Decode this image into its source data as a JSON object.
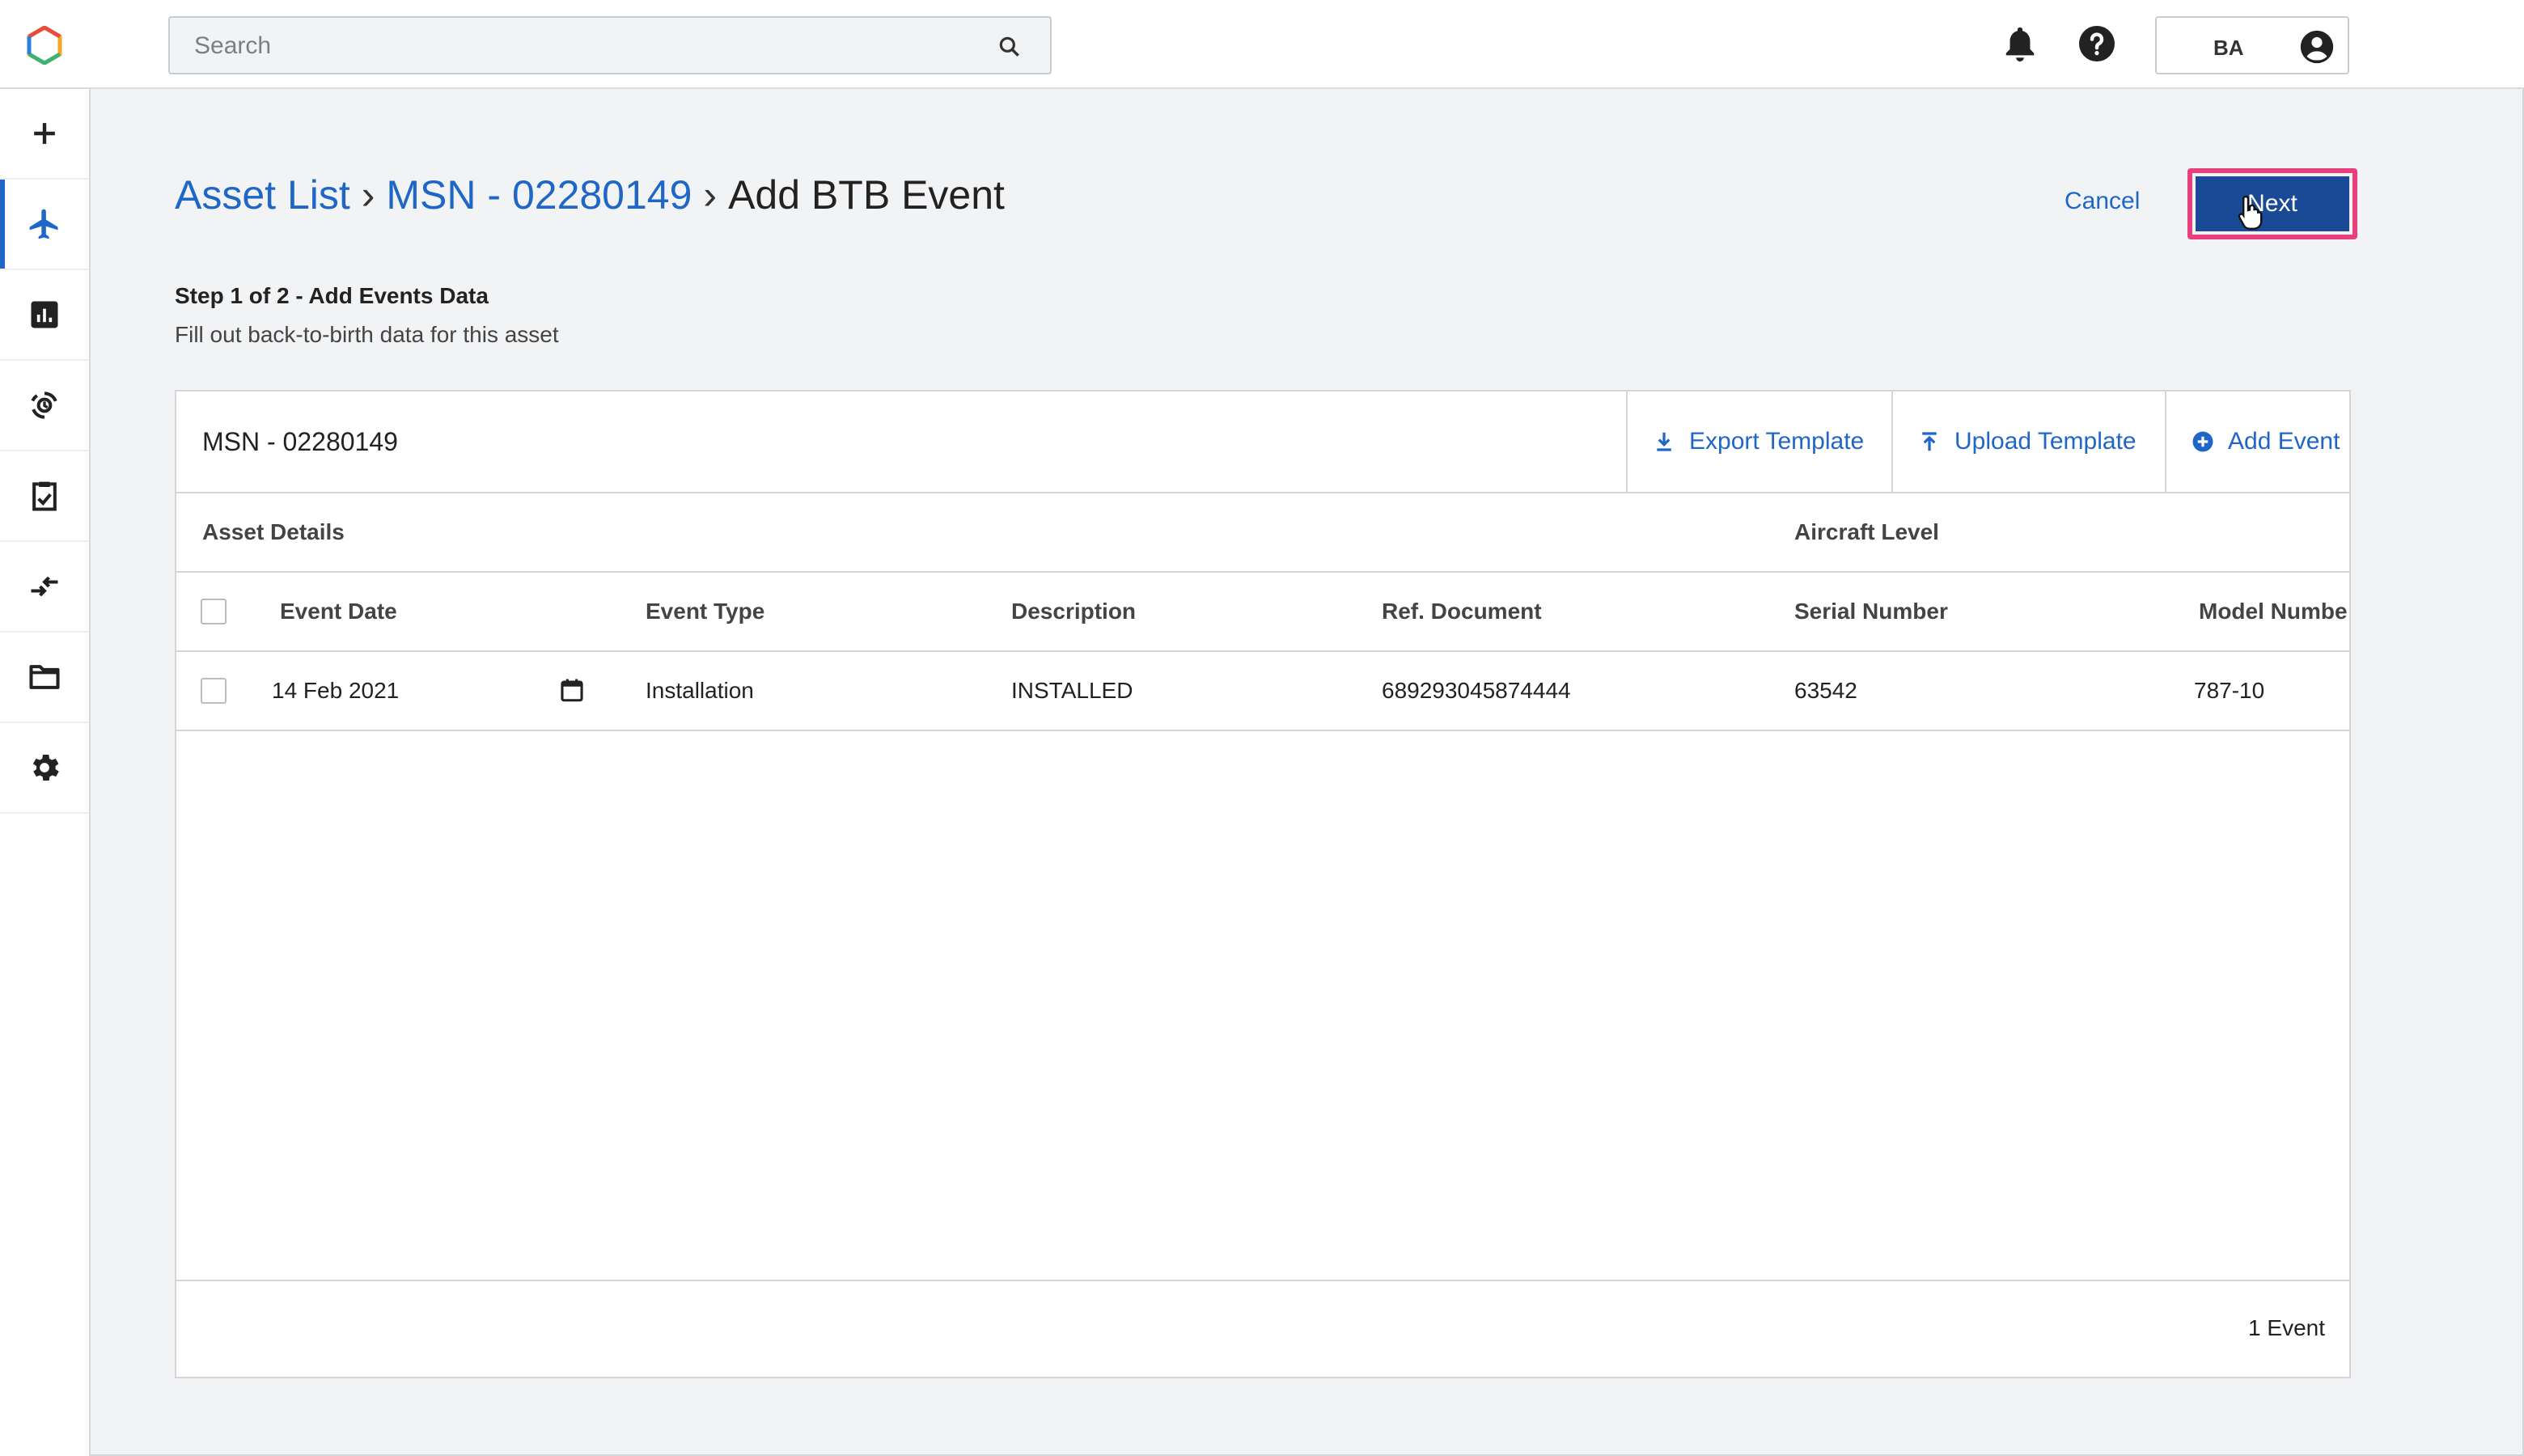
{
  "header": {
    "search_placeholder": "Search",
    "user_initials": "BA"
  },
  "sidebar": {
    "items": [
      {
        "name": "add",
        "icon": "plus-icon"
      },
      {
        "name": "assets",
        "icon": "airplane-icon",
        "active": true
      },
      {
        "name": "reports",
        "icon": "bar-chart-icon"
      },
      {
        "name": "tracking",
        "icon": "sync-icon"
      },
      {
        "name": "tasks",
        "icon": "clipboard-check-icon"
      },
      {
        "name": "transfer",
        "icon": "arrows-icon"
      },
      {
        "name": "documents",
        "icon": "folder-icon"
      },
      {
        "name": "settings",
        "icon": "gear-icon"
      }
    ]
  },
  "breadcrumb": {
    "items": [
      "Asset List",
      "MSN - 02280149"
    ],
    "current": "Add BTB Event",
    "separator": "›"
  },
  "actions": {
    "cancel": "Cancel",
    "next": "Next"
  },
  "step": {
    "title": "Step 1 of 2 - Add Events Data",
    "description": "Fill out back-to-birth data for this asset"
  },
  "panel": {
    "title": "MSN - 02280149",
    "buttons": {
      "export": "Export Template",
      "upload": "Upload Template",
      "add": "Add Event"
    },
    "groups": {
      "asset_details": "Asset Details",
      "aircraft_level": "Aircraft Level"
    },
    "columns": [
      "Event Date",
      "Event Type",
      "Description",
      "Ref. Document",
      "Serial Number",
      "Model Numbe"
    ],
    "rows": [
      {
        "event_date": "14 Feb 2021",
        "event_type": "Installation",
        "description": "INSTALLED",
        "ref_document": "689293045874444",
        "serial_number": "63542",
        "model_number": "787-10"
      }
    ],
    "footer_count": "1 Event"
  },
  "colors": {
    "accent": "#1f66c6",
    "primary_button": "#1a4a96",
    "highlight": "#e8407e"
  }
}
